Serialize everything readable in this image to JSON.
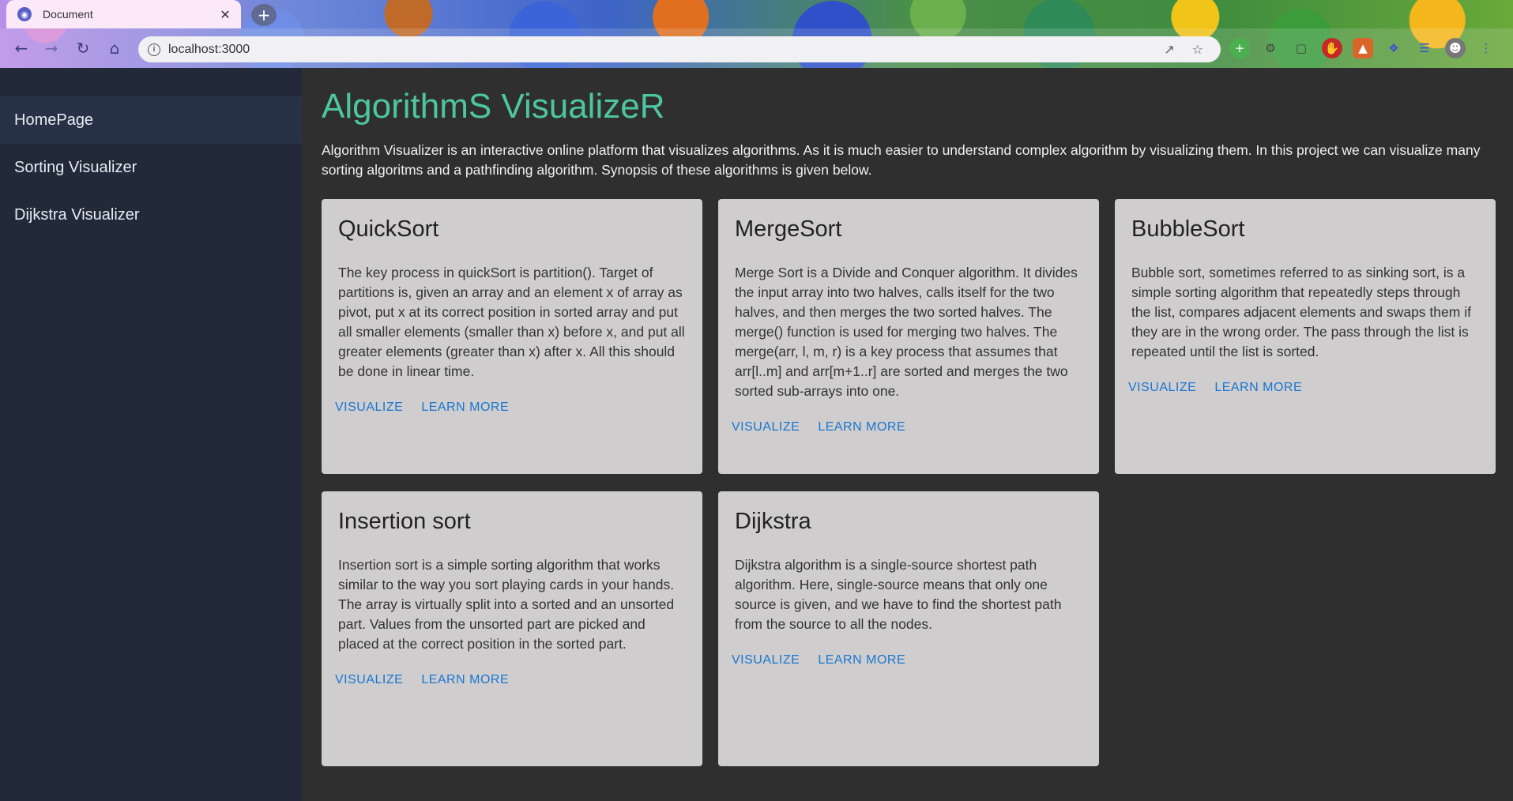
{
  "browser": {
    "tab_title": "Document",
    "new_tab": "+",
    "url": "localhost:3000"
  },
  "sidebar": {
    "items": [
      {
        "label": "HomePage"
      },
      {
        "label": "Sorting Visualizer"
      },
      {
        "label": "Dijkstra Visualizer"
      }
    ]
  },
  "main": {
    "title": "AlgorithmS VisualizeR",
    "intro": "Algorithm Visualizer is an interactive online platform that visualizes algorithms. As it is much easier to understand complex algorithm by visualizing them. In this project we can visualize many sorting algoritms and a pathfinding algorithm. Synopsis of these algorithms is given below.",
    "visualize_label": "VISUALIZE",
    "learn_more_label": "LEARN MORE",
    "cards": [
      {
        "title": "QuickSort",
        "text": "The key process in quickSort is partition(). Target of partitions is, given an array and an element x of array as pivot, put x at its correct position in sorted array and put all smaller elements (smaller than x) before x, and put all greater elements (greater than x) after x. All this should be done in linear time."
      },
      {
        "title": "MergeSort",
        "text": "Merge Sort is a Divide and Conquer algorithm. It divides the input array into two halves, calls itself for the two halves, and then merges the two sorted halves. The merge() function is used for merging two halves. The merge(arr, l, m, r) is a key process that assumes that arr[l..m] and arr[m+1..r] are sorted and merges the two sorted sub-arrays into one."
      },
      {
        "title": "BubbleSort",
        "text": "Bubble sort, sometimes referred to as sinking sort, is a simple sorting algorithm that repeatedly steps through the list, compares adjacent elements and swaps them if they are in the wrong order. The pass through the list is repeated until the list is sorted."
      },
      {
        "title": "Insertion sort",
        "text": "Insertion sort is a simple sorting algorithm that works similar to the way you sort playing cards in your hands. The array is virtually split into a sorted and an unsorted part. Values from the unsorted part are picked and placed at the correct position in the sorted part."
      },
      {
        "title": "Dijkstra",
        "text": "Dijkstra algorithm is a single-source shortest path algorithm. Here, single-source means that only one source is given, and we have to find the shortest path from the source to all the nodes."
      }
    ]
  },
  "colors": {
    "title_accent": "#4dc6a0",
    "button_blue": "#1976d2",
    "sidebar_bg": "#222a3a",
    "main_bg": "#2f2f2f",
    "card_bg": "#cfcdcd"
  }
}
